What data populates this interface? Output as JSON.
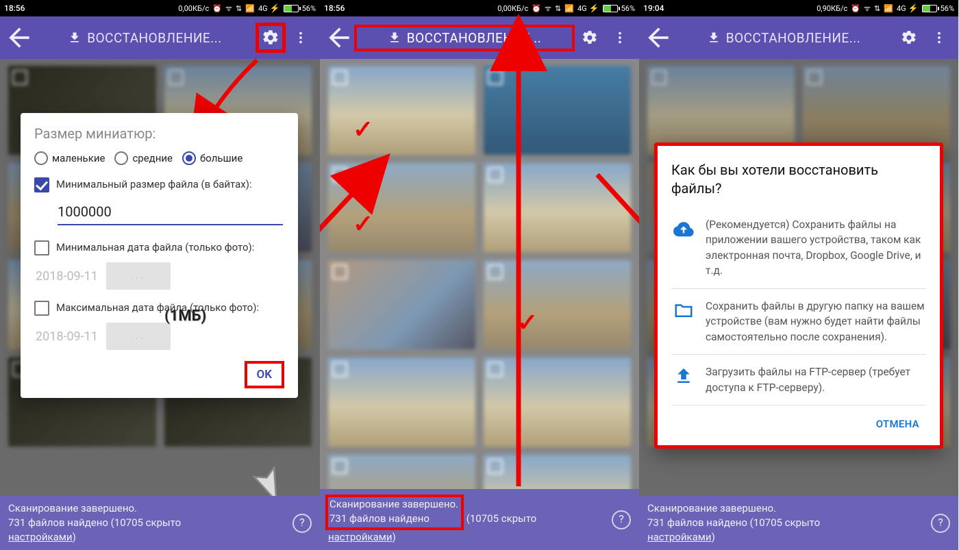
{
  "status": {
    "time_a": "18:56",
    "time_b": "18:56",
    "time_c": "19:04",
    "net_a": "0,00КБ/с",
    "net_b": "0,00КБ/с",
    "net_c": "0,90КБ/с",
    "signal": "4G",
    "battery": "56%"
  },
  "appbar": {
    "title": "ВОССТАНОВЛЕНИЕ..."
  },
  "dialog1": {
    "title": "Размер миниатюр:",
    "radio_small": "маленькие",
    "radio_medium": "средние",
    "radio_large": "большие",
    "min_size_label": "Минимальный размер файла (в байтах):",
    "min_size_value": "1000000",
    "min_size_annotation": "(1МБ)",
    "min_date_label": "Минимальная дата файла (только фото):",
    "date_value": "2018-09-11",
    "date_btn": "...",
    "max_date_label": "Максимальная дата файла (только фото):",
    "ok": "OK"
  },
  "bottom": {
    "line1": "Сканирование завершено.",
    "line2a": "731 файлов найдено",
    "line2b": " (10705 скрыто ",
    "line3": "настройками",
    "line3b": ")"
  },
  "dialog3": {
    "title": "Как бы вы хотели восстановить файлы?",
    "opt1": "(Рекомендуется) Сохранить файлы на приложении вашего устройства, таком как электронная почта, Dropbox, Google Drive, и т.д.",
    "opt2": "Сохранить файлы в другую папку на вашем устройстве (вам нужно будет найти файлы самостоятельно после сохранения).",
    "opt3": "Загрузить файлы на FTP-сервер (требует доступа к FTP-серверу).",
    "cancel": "ОТМЕНА"
  }
}
